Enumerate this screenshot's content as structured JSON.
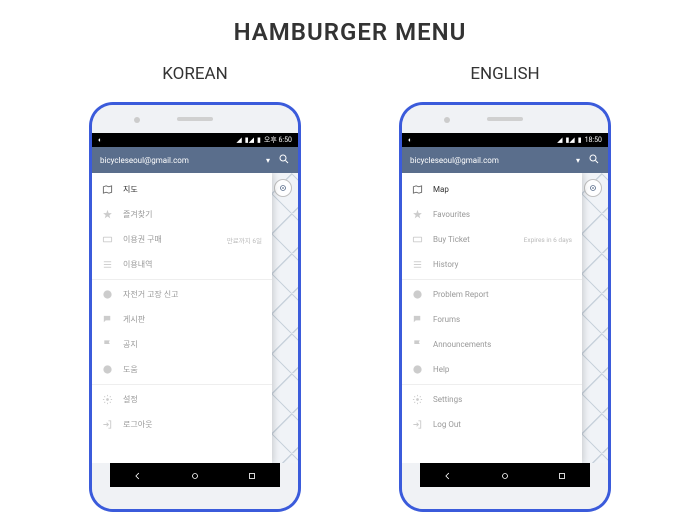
{
  "title": "HAMBURGER MENU",
  "phones": {
    "korean": {
      "lang_label": "KOREAN",
      "status_time": "오후 6:50",
      "account_email": "bicycleseoul@gmail.com",
      "menu": {
        "map": "지도",
        "favourites": "즐겨찾기",
        "buy_ticket": "이용권 구매",
        "buy_ticket_sub": "만료까지 6일",
        "history": "이용내역",
        "problem_report": "자전거 고장 신고",
        "forums": "게시판",
        "announcements": "공지",
        "help": "도움",
        "settings": "설정",
        "logout": "로그아웃"
      }
    },
    "english": {
      "lang_label": "ENGLISH",
      "status_time": "18:50",
      "account_email": "bicycleseoul@gmail.com",
      "menu": {
        "map": "Map",
        "favourites": "Favourites",
        "buy_ticket": "Buy Ticket",
        "buy_ticket_sub": "Expires in 6 days",
        "history": "History",
        "problem_report": "Problem Report",
        "forums": "Forums",
        "announcements": "Announcements",
        "help": "Help",
        "settings": "Settings",
        "logout": "Log Out"
      }
    }
  }
}
